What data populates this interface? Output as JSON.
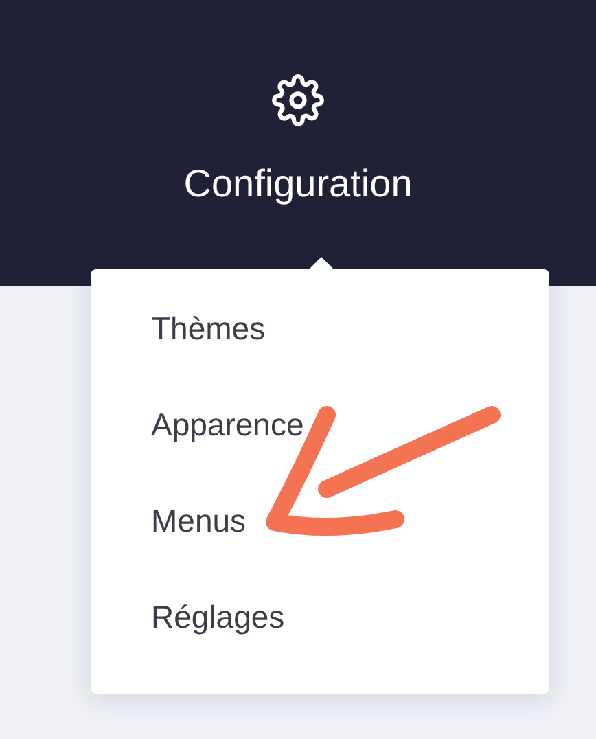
{
  "header": {
    "title": "Configuration"
  },
  "menu": {
    "items": [
      {
        "label": "Thèmes"
      },
      {
        "label": "Apparence"
      },
      {
        "label": "Menus"
      },
      {
        "label": "Réglages"
      }
    ]
  }
}
